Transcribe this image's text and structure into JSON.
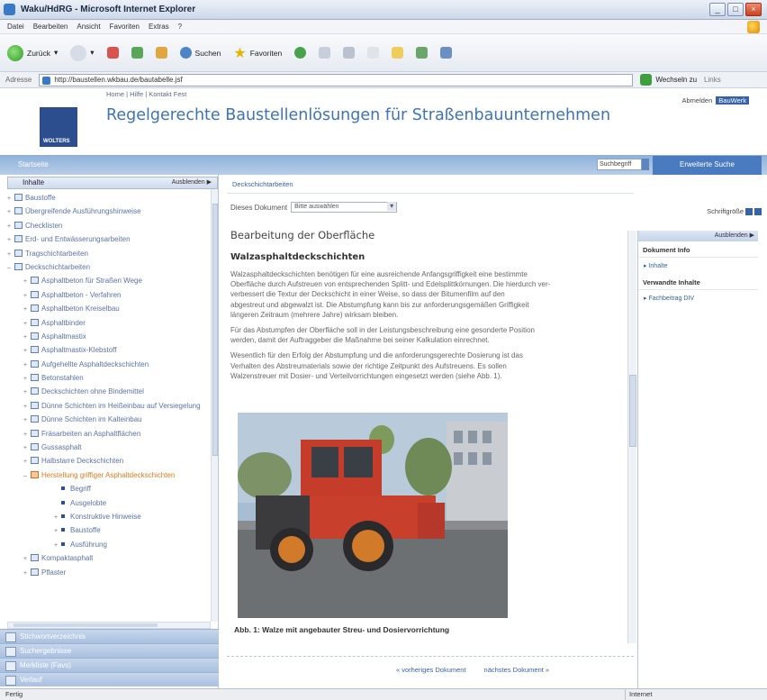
{
  "window": {
    "title": "Waku/HdRG - Microsoft Internet Explorer"
  },
  "menu": [
    "Datei",
    "Bearbeiten",
    "Ansicht",
    "Favoriten",
    "Extras",
    "?"
  ],
  "toolbar": {
    "back": "Zurück",
    "search": "Suchen",
    "favorites": "Favoriten"
  },
  "address": {
    "label": "Adresse",
    "url": "http://baustellen.wkbau.de/bautabelle.jsf",
    "go": "Wechseln zu",
    "links": "Links"
  },
  "header": {
    "top_links": "Home | Hilfe | Kontakt Fest",
    "logo_text": "WOLTERS",
    "site_title": "Regelgerechte Baustellenlösungen für Straßenbauunternehmen",
    "right_label": "Abmelden",
    "right_btn": "BauWerk"
  },
  "band": {
    "left": "Startseite",
    "search_value": "Suchbegriff",
    "tab": "Erweiterte Suche"
  },
  "left": {
    "heading": "Inhalte",
    "heading_right": "Ausblenden ▶",
    "tree": [
      {
        "label": "Baustoffe",
        "level": 1,
        "toggle": "+"
      },
      {
        "label": "Übergreifende Ausführungshinweise",
        "level": 1,
        "toggle": "+"
      },
      {
        "label": "Checklisten",
        "level": 1,
        "toggle": "+"
      },
      {
        "label": "Erd- und Entwässerungsarbeiten",
        "level": 1,
        "toggle": "+"
      },
      {
        "label": "Tragschichtarbeiten",
        "level": 1,
        "toggle": "+"
      },
      {
        "label": "Deckschichtarbeiten",
        "level": 1,
        "toggle": "–"
      },
      {
        "label": "Asphaltbeton für Straßen Wege",
        "level": 2,
        "toggle": "+"
      },
      {
        "label": "Asphaltbeton - Verfahren",
        "level": 2,
        "toggle": "+"
      },
      {
        "label": "Asphaltbeton Kreiselbau",
        "level": 2,
        "toggle": "+"
      },
      {
        "label": "Asphaltbinder",
        "level": 2,
        "toggle": "+"
      },
      {
        "label": "Asphaltmastix",
        "level": 2,
        "toggle": "+"
      },
      {
        "label": "Asphaltmastix-Klebstoff",
        "level": 2,
        "toggle": "+"
      },
      {
        "label": "Aufgehellte Asphaltdeckschichten",
        "level": 2,
        "toggle": "+"
      },
      {
        "label": "Betonstahlen",
        "level": 2,
        "toggle": "+"
      },
      {
        "label": "Deckschichten ohne Bindemittel",
        "level": 2,
        "toggle": "+"
      },
      {
        "label": "Dünne Schichten im Heißeinbau auf Versiegelung",
        "level": 2,
        "toggle": "+"
      },
      {
        "label": "Dünne Schichten im Kalteinbau",
        "level": 2,
        "toggle": "+"
      },
      {
        "label": "Fräsarbeiten an Asphaltflächen",
        "level": 2,
        "toggle": "+"
      },
      {
        "label": "Gussasphalt",
        "level": 2,
        "toggle": "+"
      },
      {
        "label": "Halbstarre Deckschichten",
        "level": 2,
        "toggle": "+"
      },
      {
        "label": "Herstellung griffiger Asphaltdeckschichten",
        "level": 2,
        "toggle": "–",
        "active": true
      },
      {
        "label": "Begriff",
        "level": 3,
        "toggle": ""
      },
      {
        "label": "Ausgelobte",
        "level": 3,
        "toggle": ""
      },
      {
        "label": "Konstruktive Hinweise",
        "level": 3,
        "toggle": "+"
      },
      {
        "label": "Baustoffe",
        "level": 3,
        "toggle": "+"
      },
      {
        "label": "Ausführung",
        "level": 3,
        "toggle": "+"
      },
      {
        "label": "Kompaktasphalt",
        "level": 2,
        "toggle": "+"
      },
      {
        "label": "Pflaster",
        "level": 2,
        "toggle": "+"
      }
    ],
    "panels": [
      "Stichwortverzeichnis",
      "Suchergebnisse",
      "Merkliste (Favs)",
      "Verlauf"
    ]
  },
  "main": {
    "breadcrumb": "Deckschichtarbeiten",
    "doc_select_label": "Dieses Dokument",
    "doc_select_value": "Bitte auswählen",
    "title": "Bearbeitung der Oberfläche",
    "subtitle": "Walzasphaltdeckschichten",
    "paragraphs": [
      "Walzasphaltdeckschichten benötigen für eine ausreichende Anfangsgriffigkeit eine bestimmte",
      "Oberfläche durch Aufstreuen von entsprechenden Splitt- und Edelsplittkörnungen. Die hierdurch ver-",
      "verbessert die Textur der Deckschicht in einer Weise, so dass der Bitumenfilm auf den",
      "abgestreut und abgewalzt ist. Die Abstumpfung kann bis zur anforderungsgemäßen Griffigkeit",
      "längeren Zeitraum (mehrere Jahre) wirksam bleiben.",
      "Für das Abstumpfen der Oberfläche soll in der Leistungsbeschreibung eine gesonderte Position",
      "werden, damit der Auftraggeber die Maßnahme bei seiner Kalkulation einrechnet.",
      "Wesentlich für den Erfolg der Abstumpfung und die anforderungsgerechte Dosierung ist das",
      "Verhalten des Abstreumaterials sowie der richtige Zeitpunkt des Aufstreuens. Es sollen",
      "Walzenstreuer mit Dosier- und Verteilvorrichtungen eingesetzt werden (siehe Abb. 1)."
    ],
    "caption": "Abb. 1: Walze mit angebauter Streu- und Dosiervorrichtung",
    "pager_prev": "« vorheriges Dokument",
    "pager_next": "nächstes Dokument »"
  },
  "right": {
    "font_label": "Schriftgröße",
    "head": "Ausblenden ▶",
    "sec1": "Dokument Info",
    "link1": "Inhalte",
    "sec2": "Verwandte Inhalte",
    "link2": "Fachbeitrag DIV"
  },
  "status": {
    "left": "Fertig",
    "zone": "Internet"
  }
}
